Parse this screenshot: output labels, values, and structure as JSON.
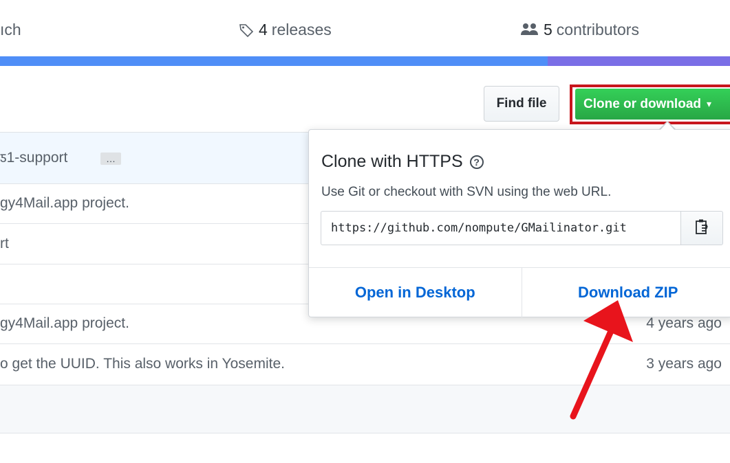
{
  "summary": {
    "branch_partial": "ıch",
    "releases": {
      "count": "4",
      "label": "releases",
      "icon": "tag-icon"
    },
    "contributors": {
      "count": "5",
      "label": "contributors",
      "icon": "people-icon"
    }
  },
  "language_bar": [
    {
      "color": "#4f8ef7",
      "fraction": 0.75
    },
    {
      "color": "#7a6ee6",
      "fraction": 0.25
    }
  ],
  "toolbar": {
    "find_file_label": "Find file",
    "clone_label": "Clone or download",
    "clone_highlight_color": "#c8161d"
  },
  "files": [
    {
      "message": "ƽ1-support",
      "age": "",
      "has_ellipsis": true,
      "ellipsis": "…",
      "highlighted": true
    },
    {
      "message": "gy4Mail.app project.",
      "age": ""
    },
    {
      "message": "rt",
      "age": ""
    },
    {
      "message": "",
      "age": ""
    },
    {
      "message": "gy4Mail.app project.",
      "age": "4 years ago"
    },
    {
      "message": "o get the UUID. This also works in Yosemite.",
      "age": "3 years ago"
    },
    {
      "message": "",
      "age": ""
    }
  ],
  "dropdown": {
    "title": "Clone with HTTPS",
    "help_icon": "question-circle-icon",
    "description": "Use Git or checkout with SVN using the web URL.",
    "url": "https://github.com/nompute/GMailinator.git",
    "clipboard_icon": "clipboard-icon",
    "open_desktop_label": "Open in Desktop",
    "download_zip_label": "Download ZIP"
  },
  "annotation": {
    "color": "#e8141c",
    "icon": "red-arrow-annotation"
  }
}
